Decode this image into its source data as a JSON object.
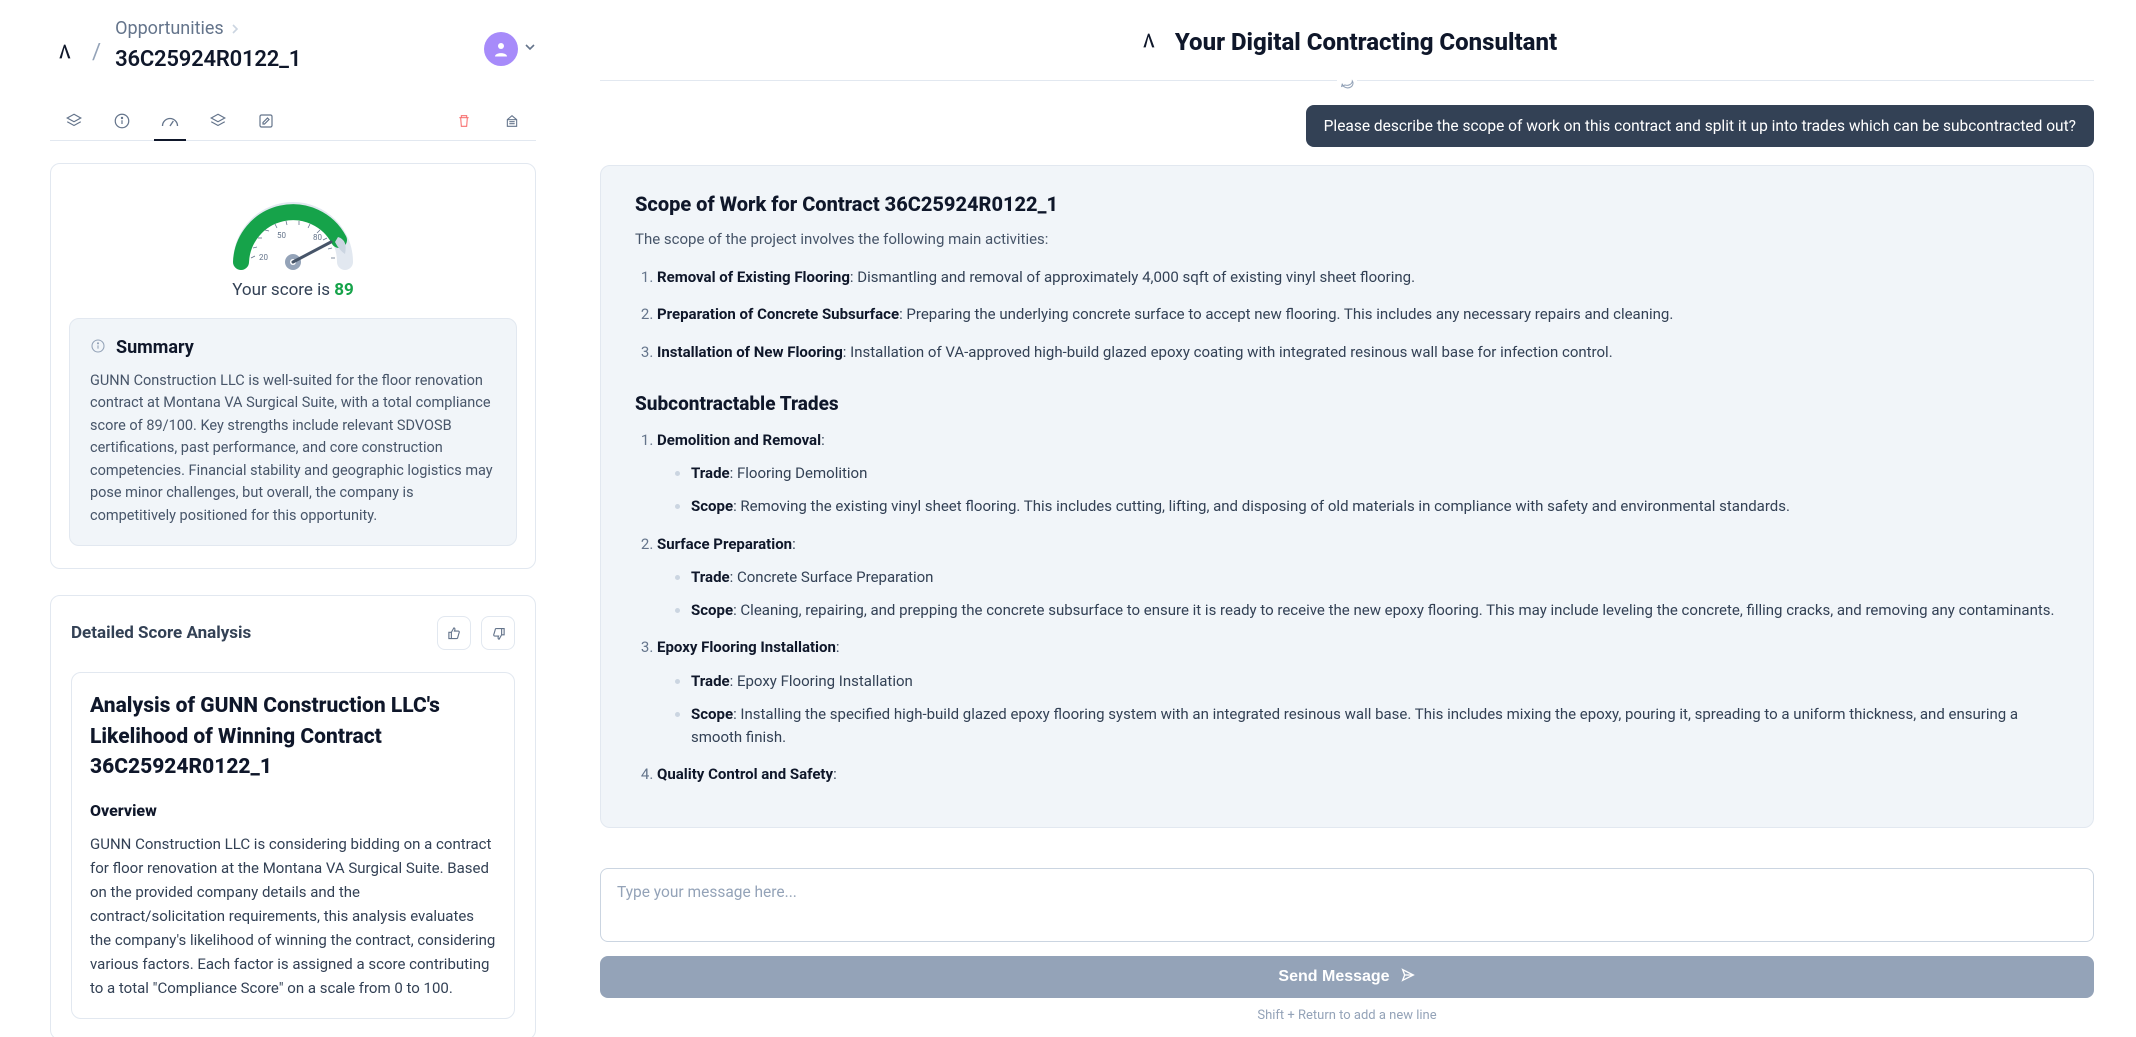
{
  "breadcrumb": {
    "parent": "Opportunities",
    "id": "36C25924R0122_1"
  },
  "score": {
    "label_prefix": "Your score is ",
    "value": "89"
  },
  "summary": {
    "title": "Summary",
    "body": "GUNN Construction LLC is well-suited for the floor renovation contract at Montana VA Surgical Suite, with a total compliance score of 89/100. Key strengths include relevant SDVOSB certifications, past performance, and core construction competencies. Financial stability and geographic logistics may pose minor challenges, but overall, the company is competitively positioned for this opportunity."
  },
  "detailed": {
    "title": "Detailed Score Analysis",
    "analysis_title": "Analysis of GUNN Construction LLC's Likelihood of Winning Contract 36C25924R0122_1",
    "overview_h": "Overview",
    "overview_body": "GUNN Construction LLC is considering bidding on a contract for floor renovation at the Montana VA Surgical Suite. Based on the provided company details and the contract/solicitation requirements, this analysis evaluates the company's likelihood of winning the contract, considering various factors. Each factor is assigned a score contributing to a total \"Compliance Score\" on a scale from 0 to 100."
  },
  "chat": {
    "title": "Your Digital Contracting Consultant",
    "user_msg": "Please describe the scope of work on this contract and split it up into trades which can be subcontracted out?",
    "response": {
      "h1": "Scope of Work for Contract 36C25924R0122_1",
      "intro": "The scope of the project involves the following main activities:",
      "activities": [
        {
          "b": "Removal of Existing Flooring",
          "t": ": Dismantling and removal of approximately 4,000 sqft of existing vinyl sheet flooring."
        },
        {
          "b": "Preparation of Concrete Subsurface",
          "t": ": Preparing the underlying concrete surface to accept new flooring. This includes any necessary repairs and cleaning."
        },
        {
          "b": "Installation of New Flooring",
          "t": ": Installation of VA-approved high-build glazed epoxy coating with integrated resinous wall base for infection control."
        }
      ],
      "h2": "Subcontractable Trades",
      "trades": [
        {
          "title": "Demolition and Removal",
          "trade": "Flooring Demolition",
          "scope": "Removing the existing vinyl sheet flooring. This includes cutting, lifting, and disposing of old materials in compliance with safety and environmental standards."
        },
        {
          "title": "Surface Preparation",
          "trade": "Concrete Surface Preparation",
          "scope": "Cleaning, repairing, and prepping the concrete subsurface to ensure it is ready to receive the new epoxy flooring. This may include leveling the concrete, filling cracks, and removing any contaminants."
        },
        {
          "title": "Epoxy Flooring Installation",
          "trade": "Epoxy Flooring Installation",
          "scope": "Installing the specified high-build glazed epoxy flooring system with an integrated resinous wall base. This includes mixing the epoxy, pouring it, spreading to a uniform thickness, and ensuring a smooth finish."
        },
        {
          "title": "Quality Control and Safety",
          "trade": "",
          "scope": ""
        }
      ]
    },
    "composer": {
      "placeholder": "Type your message here...",
      "send_label": "Send Message",
      "hint": "Shift + Return to add a new line"
    }
  }
}
